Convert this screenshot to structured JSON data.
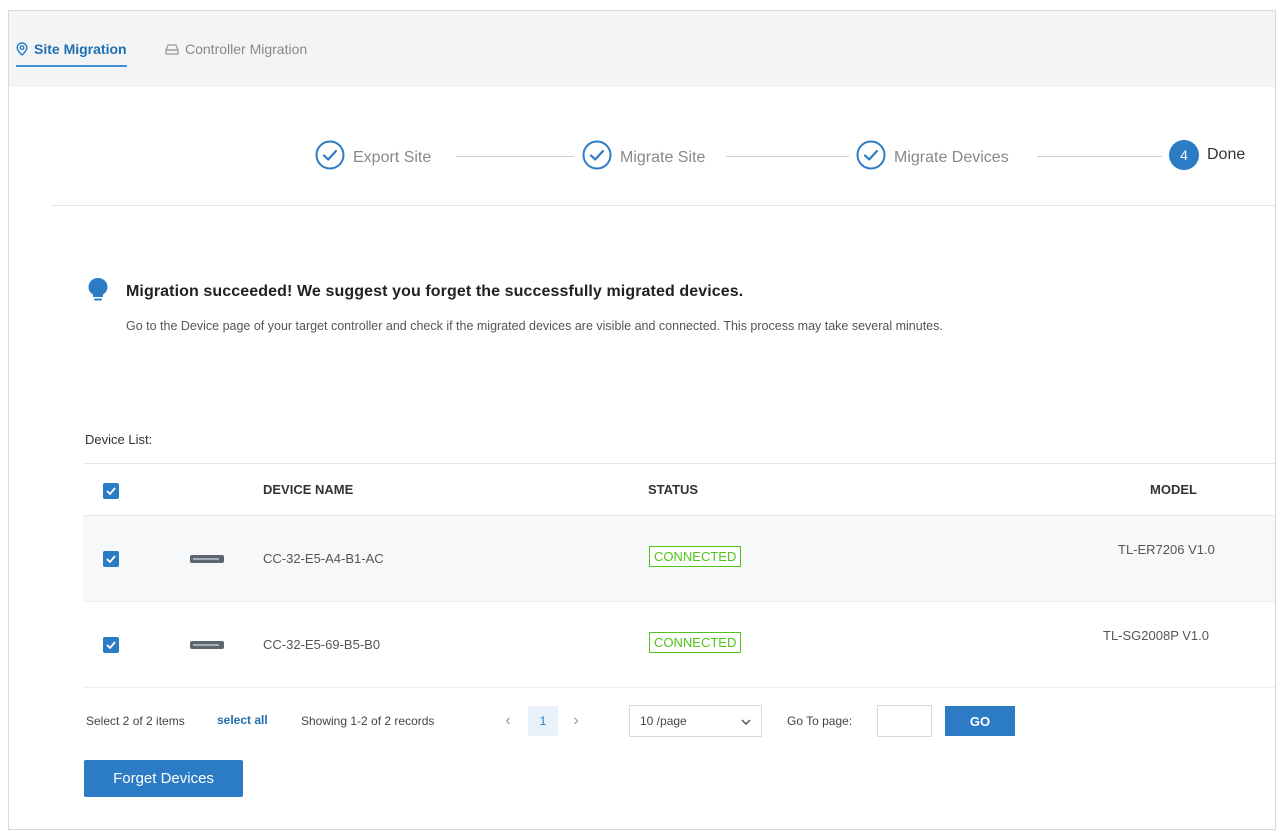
{
  "tabs": {
    "site_migration": "Site Migration",
    "controller_migration": "Controller Migration"
  },
  "steps": [
    {
      "label": "Export Site",
      "state": "completed"
    },
    {
      "label": "Migrate Site",
      "state": "completed"
    },
    {
      "label": "Migrate Devices",
      "state": "completed"
    },
    {
      "label": "Done",
      "number": "4",
      "state": "current"
    }
  ],
  "message": {
    "title": "Migration succeeded! We suggest you forget the successfully migrated devices.",
    "body": "Go to the Device page of your target controller and check if the migrated devices are visible and connected. This process may take several minutes."
  },
  "device_list": {
    "label": "Device List:",
    "columns": {
      "name": "DEVICE NAME",
      "status": "STATUS",
      "model": "MODEL"
    },
    "rows": [
      {
        "checked": true,
        "name": "CC-32-E5-A4-B1-AC",
        "status": "CONNECTED",
        "model": "TL-ER7206 V1.0"
      },
      {
        "checked": true,
        "name": "CC-32-E5-69-B5-B0",
        "status": "CONNECTED",
        "model": "TL-SG2008P V1.0"
      }
    ]
  },
  "pagination": {
    "selection_text": "Select 2 of 2 items",
    "select_all": "select all",
    "showing": "Showing 1-2 of 2 records",
    "current_page": "1",
    "page_size": "10 /page",
    "goto_label": "Go To page:",
    "goto_value": "",
    "go_button": "GO"
  },
  "actions": {
    "forget_devices": "Forget Devices"
  },
  "colors": {
    "primary": "#2b7cc4",
    "success": "#52c41a"
  }
}
